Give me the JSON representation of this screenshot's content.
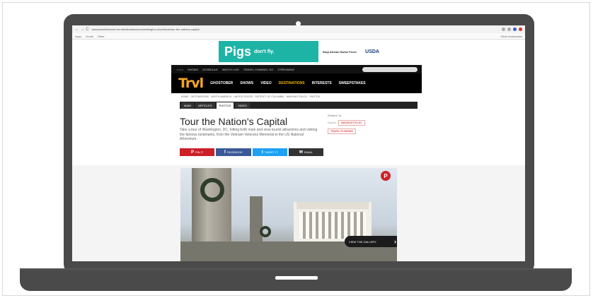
{
  "browser": {
    "url": "www.travelchannel.com/destinations/us/washington-dc/photos/tour-the-nations-capital",
    "nav_icons": "← → C",
    "bookmarks": [
      "Apps",
      "Gmail",
      "Other"
    ],
    "other_bookmarks": "Other bookmarks"
  },
  "ad": {
    "headline": "Pigs",
    "tagline": "don't fly.",
    "cta": "Stop African Swine Fever",
    "sponsor": "USDA"
  },
  "topnav": {
    "items": [
      "• • • •",
      "SHOWS",
      "SCHEDULE",
      "WATCH LIVE",
      "TRAVEL CHANNEL GO",
      "STREAMING"
    ]
  },
  "mainnav": {
    "logo": "Trvl",
    "items": [
      "GHOSTOBER",
      "SHOWS",
      "VIDEO",
      "DESTINATIONS",
      "INTERESTS",
      "SWEEPSTAKES"
    ],
    "active": "DESTINATIONS"
  },
  "breadcrumb": [
    "HOME",
    "DESTINATIONS",
    "NORTH AMERICA",
    "UNITED STATES",
    "DISTRICT OF COLUMBIA",
    "WASHINGTON DC",
    "PHOTOS"
  ],
  "tabs": [
    "MAIN",
    "ARTICLES",
    "PHOTOS",
    "VIDEO"
  ],
  "active_tab": "PHOTOS",
  "article": {
    "title": "Tour the Nation's Capital",
    "description": "Take a tour of Washington, DC, hitting both main and slow tourist attractions and visiting the famous landmarks, from the Vietnam Veterans Memorial to the US National Arboretum."
  },
  "related": {
    "heading": "Related To:",
    "tags": [
      "WASHINGTON DC",
      "TRAVEL PLANNING"
    ],
    "label": "Explore"
  },
  "share": {
    "pinterest": "PIN IT",
    "facebook": "FACEBOOK",
    "twitter": "TWEET IT",
    "email": "EMAIL",
    "pin_glyph": "P",
    "fb_glyph": "f",
    "tw_glyph": "t",
    "em_glyph": "✉"
  },
  "gallery": {
    "view_label": "VIEW THE GALLERY",
    "chevron": "›",
    "pin_badge": "P"
  }
}
